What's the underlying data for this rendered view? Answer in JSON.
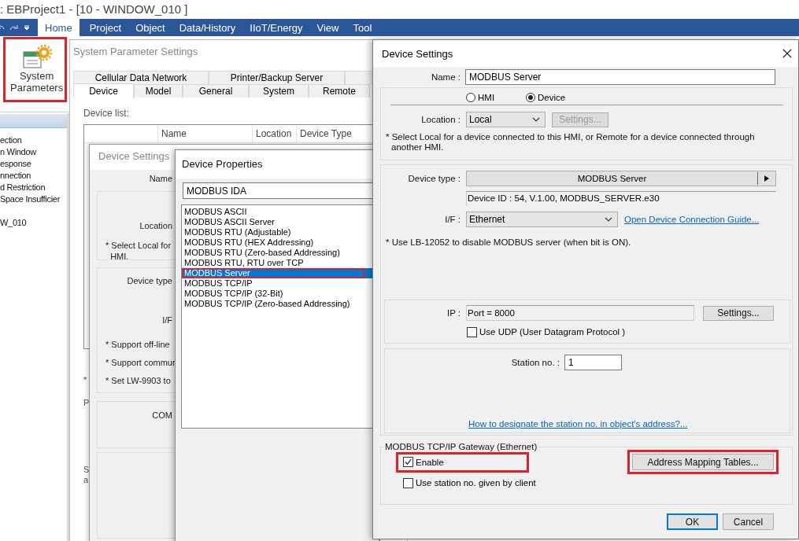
{
  "window": {
    "title": ": EBProject1 - [10 - WINDOW_010 ]"
  },
  "ribbon": {
    "tabs": [
      {
        "label": "Home",
        "selected": true
      },
      {
        "label": "Project",
        "selected": false
      },
      {
        "label": "Object",
        "selected": false
      },
      {
        "label": "Data/History",
        "selected": false
      },
      {
        "label": "IIoT/Energy",
        "selected": false
      },
      {
        "label": "View",
        "selected": false
      },
      {
        "label": "Tool",
        "selected": false
      }
    ],
    "button": {
      "label": "System Parameters",
      "highlighted": true
    }
  },
  "project_tree": {
    "groups": [
      [
        "ection",
        "n Window",
        "esponse",
        "nnection",
        "d Restriction",
        "Space Insufficier"
      ],
      [
        "W_010"
      ]
    ]
  },
  "system_parameter_settings": {
    "title": "System Parameter Settings",
    "tab_rows": [
      [
        {
          "label": "Cellular Data Network",
          "selected": false
        },
        {
          "label": "Printer/Backup Server",
          "selected": false
        },
        {
          "selected": false
        }
      ],
      [
        {
          "label": "Device",
          "selected": true
        },
        {
          "label": "Model",
          "selected": false
        },
        {
          "label": "General",
          "selected": false
        },
        {
          "label": "System",
          "selected": false
        },
        {
          "label": "Remote",
          "selected": false
        }
      ]
    ],
    "device_list_label": "Device list:",
    "table": {
      "columns": [
        "",
        "Name",
        "Location",
        "Device Type"
      ]
    },
    "fragments": [
      "*",
      "P",
      "S",
      "a"
    ]
  },
  "device_settings_behind": {
    "title": "Device Settings",
    "name_label": "Name",
    "location_label": "Location",
    "location_note": [
      "* Select Local for",
      "HMI."
    ],
    "device_type_label": "Device type",
    "if_label": "I/F",
    "notes": [
      "* Support off-line",
      "* Support commur",
      "* Set LW-9903 to"
    ],
    "com_label": "COM"
  },
  "device_properties": {
    "title": "Device Properties",
    "search": {
      "value": "MODBUS IDA"
    },
    "items": [
      {
        "label": "MODBUS ASCII",
        "selected": false,
        "highlighted": false
      },
      {
        "label": "MODBUS ASCII Server",
        "selected": false,
        "highlighted": false
      },
      {
        "label": "MODBUS RTU (Adjustable)",
        "selected": false,
        "highlighted": false
      },
      {
        "label": "MODBUS RTU (HEX Addressing)",
        "selected": false,
        "highlighted": false
      },
      {
        "label": "MODBUS RTU (Zero-based Addressing)",
        "selected": false,
        "highlighted": false
      },
      {
        "label": "MODBUS RTU, RTU over TCP",
        "selected": false,
        "highlighted": false
      },
      {
        "label": "MODBUS Server",
        "selected": true,
        "highlighted": true
      },
      {
        "label": "MODBUS TCP/IP",
        "selected": false,
        "highlighted": false
      },
      {
        "label": "MODBUS TCP/IP (32-Bit)",
        "selected": false,
        "highlighted": false
      },
      {
        "label": "MODBUS TCP/IP (Zero-based Addressing)",
        "selected": false,
        "highlighted": false
      }
    ]
  },
  "device_settings": {
    "title": "Device Settings",
    "name_label": "Name :",
    "name_value": "MODBUS Server",
    "radios": [
      {
        "label": "HMI",
        "selected": false
      },
      {
        "label": "Device",
        "selected": true
      }
    ],
    "location_label": "Location :",
    "location_value": "Local",
    "location_settings": {
      "label": "Settings...",
      "disabled": true
    },
    "location_note": "* Select Local for a device connected to this HMI, or Remote for a device connected through another HMI.",
    "device_type_label": "Device type :",
    "device_type_value": "MODBUS Server",
    "device_id": "Device ID : 54, V.1.00, MODBUS_SERVER.e30",
    "if_label": "I/F :",
    "if_value": "Ethernet",
    "guide_link": "Open Device Connection Guide...",
    "note": "* Use LB-12052 to disable MODBUS server (when bit is ON).",
    "ip_label": "IP :",
    "ip_value": "Port = 8000",
    "ip_settings": "Settings...",
    "udp": {
      "label": "Use UDP (User Datagram Protocol )",
      "checked": false
    },
    "station_label": "Station no. :",
    "station_value": "1",
    "station_link": "How to designate the station no. in object's address?...",
    "gateway": {
      "title": "MODBUS TCP/IP Gateway (Ethernet)",
      "checks": [
        {
          "label": "Enable",
          "checked": true,
          "highlighted": true
        },
        {
          "label": "Use station no. given by client",
          "checked": false,
          "highlighted": false
        }
      ],
      "button": {
        "label": "Address Mapping Tables...",
        "highlighted": true
      }
    },
    "buttons": [
      {
        "label": "OK",
        "default": true
      },
      {
        "label": "Cancel",
        "default": false
      }
    ]
  }
}
